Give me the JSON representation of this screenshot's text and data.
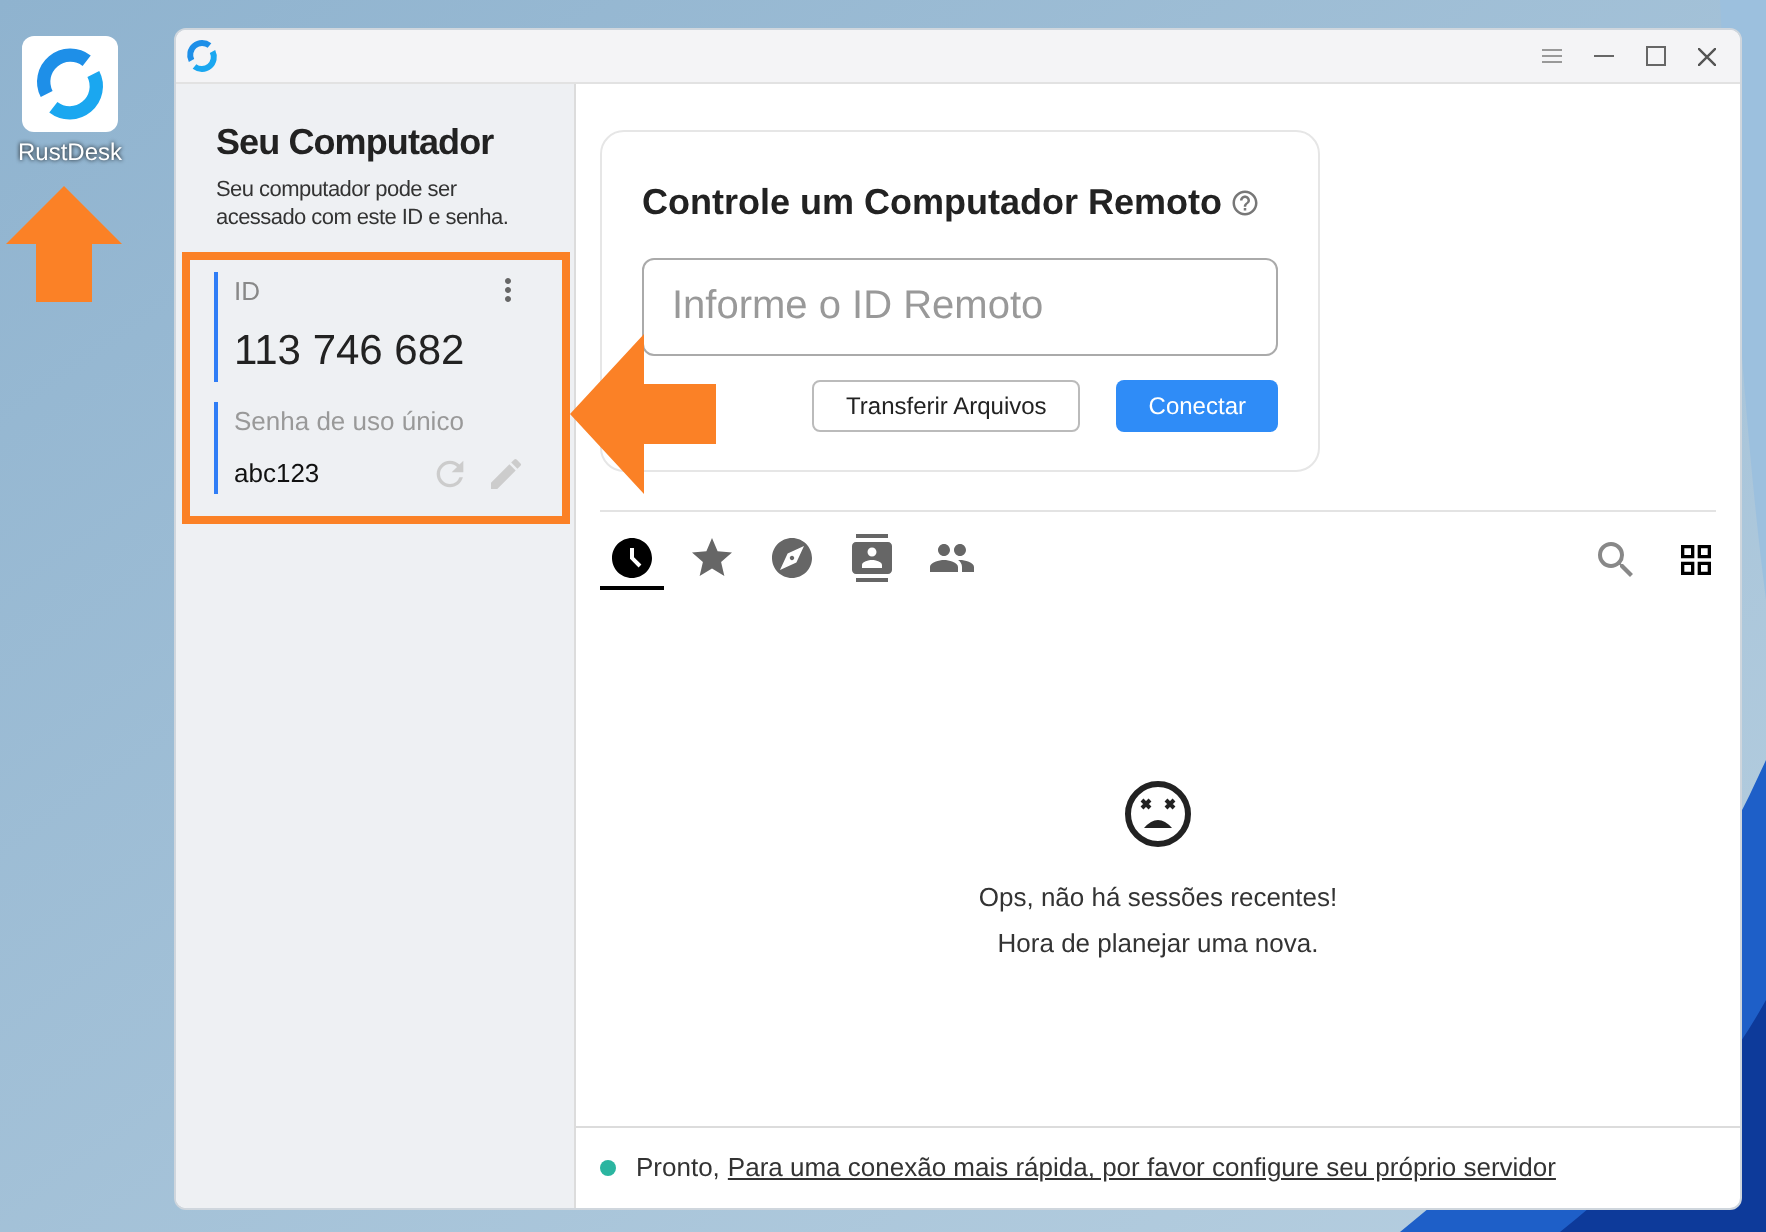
{
  "desktop": {
    "shortcut": {
      "label": "RustDesk"
    }
  },
  "sidebar": {
    "title": "Seu Computador",
    "description": "Seu computador pode ser acessado com este ID e senha.",
    "id_label": "ID",
    "id_value": "113 746 682",
    "password_label": "Senha de uso único",
    "password_value": "abc123"
  },
  "remote": {
    "title": "Controle um Computador Remoto",
    "placeholder": "Informe o ID Remoto",
    "buttons": [
      "Transferir Arquivos",
      "Conectar"
    ]
  },
  "tabs": [
    {
      "kind": "recent",
      "selected": true
    },
    {
      "kind": "favorites",
      "selected": false
    },
    {
      "kind": "discovered",
      "selected": false
    },
    {
      "kind": "addressbook",
      "selected": false
    },
    {
      "kind": "group",
      "selected": false
    }
  ],
  "empty": {
    "lines": [
      "Ops, não há sessões recentes!",
      "Hora de planejar uma nova."
    ]
  },
  "status_bar": {
    "color": "#2bb5a0",
    "status": "Pronto,",
    "link": "Para uma conexão mais rápida, por favor configure seu próprio servidor"
  }
}
